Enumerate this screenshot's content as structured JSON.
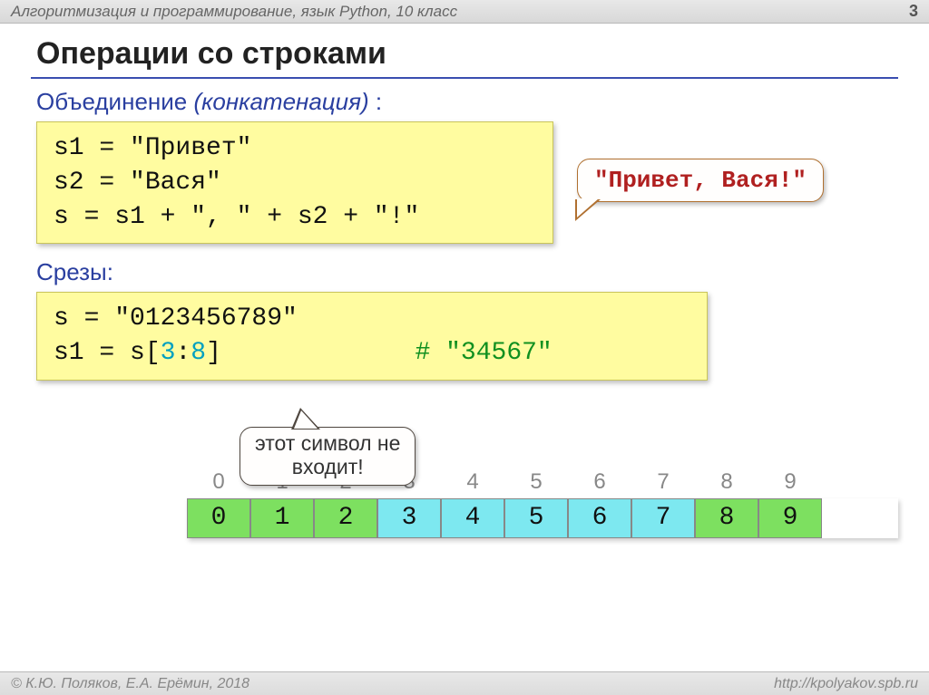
{
  "header": {
    "breadcrumb": "Алгоритмизация и программирование, язык Python, 10 класс",
    "page": "3"
  },
  "title": "Операции со строками",
  "section1": {
    "headWord": "Объединение",
    "headItal": "(конкатенация)",
    "headColon": " :",
    "code": {
      "l1": "s1 = \"Привет\"",
      "l2": "s2 = \"Вася\"",
      "l3": "s  = s1 + \", \" + s2 + \"!\""
    },
    "bubble": "\"Привет, Вася!\""
  },
  "section2": {
    "head": "Срезы:",
    "code": {
      "l1": "s = \"0123456789\"",
      "l2a": "s1 = s[",
      "l2b": "3",
      "l2c": ":",
      "l2d": "8",
      "l2e": "]",
      "comment": "# \"34567\""
    },
    "callout": {
      "l1": "этот символ не",
      "l2": "входит!"
    }
  },
  "index": {
    "labels": [
      "0",
      "1",
      "2",
      "3",
      "4",
      "5",
      "6",
      "7",
      "8",
      "9"
    ],
    "cells": [
      "0",
      "1",
      "2",
      "3",
      "4",
      "5",
      "6",
      "7",
      "8",
      "9"
    ],
    "colors": [
      "green",
      "green",
      "green",
      "cyan",
      "cyan",
      "cyan",
      "cyan",
      "cyan",
      "green",
      "green"
    ]
  },
  "footer": {
    "left": "© К.Ю. Поляков, Е.А. Ерёмин, 2018",
    "right": "http://kpolyakov.spb.ru"
  }
}
